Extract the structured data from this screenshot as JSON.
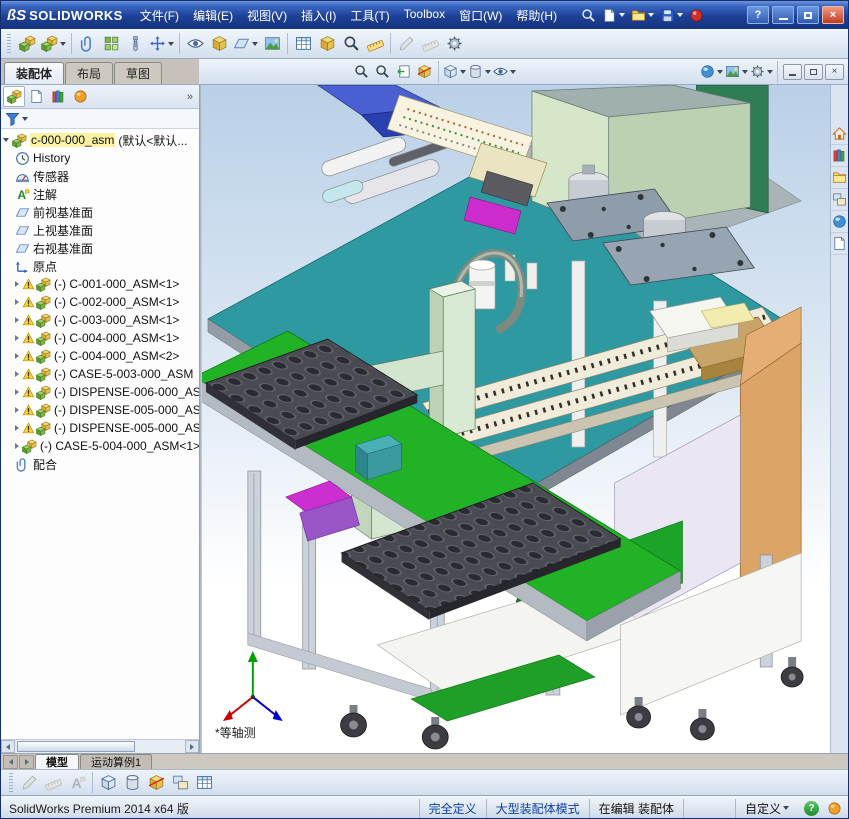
{
  "titlebar": {
    "logo_mark": "ßS",
    "logo_name": "SOLIDWORKS",
    "menus": [
      "文件(F)",
      "编辑(E)",
      "视图(V)",
      "插入(I)",
      "工具(T)",
      "Toolbox",
      "窗口(W)",
      "帮助(H)"
    ]
  },
  "glyphs": {
    "help": "?",
    "close": "×",
    "chevron_more": "»"
  },
  "command_tabs": {
    "assembly": "装配体",
    "layout": "布局",
    "sketch": "草图"
  },
  "feature_tree": {
    "root_label": "c-000-000_asm",
    "root_config": "(默认<默认...",
    "items": [
      {
        "label": "History",
        "icon": "history-icon"
      },
      {
        "label": "传感器",
        "icon": "sensors-icon"
      },
      {
        "label": "注解",
        "icon": "annotations-icon"
      },
      {
        "label": "前视基准面",
        "icon": "plane-icon"
      },
      {
        "label": "上视基准面",
        "icon": "plane-icon"
      },
      {
        "label": "右视基准面",
        "icon": "plane-icon"
      },
      {
        "label": "原点",
        "icon": "origin-icon"
      },
      {
        "label": "(-) C-001-000_ASM<1>",
        "icon": "assembly-icon",
        "warning": true
      },
      {
        "label": "(-) C-002-000_ASM<1>",
        "icon": "assembly-icon",
        "warning": true
      },
      {
        "label": "(-) C-003-000_ASM<1>",
        "icon": "assembly-icon",
        "warning": true
      },
      {
        "label": "(-) C-004-000_ASM<1>",
        "icon": "assembly-icon",
        "warning": true
      },
      {
        "label": "(-) C-004-000_ASM<2>",
        "icon": "assembly-icon",
        "warning": true
      },
      {
        "label": "(-) CASE-5-003-000_ASM",
        "icon": "assembly-icon",
        "warning": true
      },
      {
        "label": "(-) DISPENSE-006-000_AS",
        "icon": "assembly-icon",
        "warning": true
      },
      {
        "label": "(-) DISPENSE-005-000_AS",
        "icon": "assembly-icon",
        "warning": true
      },
      {
        "label": "(-) DISPENSE-005-000_AS",
        "icon": "assembly-icon",
        "warning": true
      },
      {
        "label": "(-) CASE-5-004-000_ASM<1>",
        "icon": "assembly-icon",
        "warning": false
      },
      {
        "label": "配合",
        "icon": "mates-icon"
      }
    ]
  },
  "icons": {
    "titlebar": [
      "search-icon",
      "new-document-icon",
      "open-icon",
      "save-icon",
      "red-sphere-icon"
    ],
    "main_toolbar": [
      "edit-component",
      "insert-components",
      "mate",
      "linear-component-pattern",
      "smart-fasteners",
      "move-component",
      "show-hidden-components",
      "assembly-features",
      "reference-geometry",
      "new-motion-study",
      "bill-of-materials",
      "exploded-view",
      "interference-detection",
      "measure",
      "sketch",
      "smart-dimension",
      "options"
    ],
    "view_toolbar": [
      "zoom-to-fit",
      "zoom-to-area",
      "previous-view",
      "section-view",
      "view-orientation",
      "display-style",
      "hide-show-items",
      "edit-appearance",
      "apply-scene",
      "view-settings"
    ],
    "taskpane": [
      "solidworks-resources",
      "design-library",
      "file-explorer",
      "view-palette",
      "appearances-scenes",
      "custom-properties"
    ],
    "bottom_toolbar": [
      "sketch",
      "smart-dimension",
      "note",
      "view-orientation",
      "display-style",
      "section-view",
      "view-selector",
      "table"
    ]
  },
  "viewport": {
    "view_label": "*等轴测"
  },
  "doc_tabs": {
    "model": "模型",
    "motion": "运动算例1"
  },
  "statusbar": {
    "product": "SolidWorks Premium 2014 x64 版",
    "fully_defined": "完全定义",
    "large_assembly_mode": "大型装配体模式",
    "editing": "在编辑 装配体",
    "custom": "自定义"
  },
  "colors": {
    "titlebar_blue": "#1d4096",
    "table_teal": "#2e99a1",
    "conveyor_green": "#22b226",
    "cabinet_tan": "#dda468",
    "tray_gray": "#4a4a52",
    "warning_yellow": "#ffd21e"
  }
}
